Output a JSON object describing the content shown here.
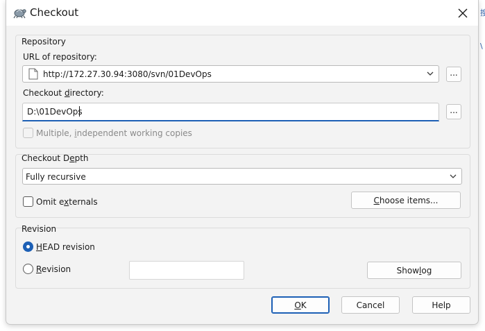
{
  "window": {
    "title": "Checkout",
    "accent": "#1c5fb5"
  },
  "background": {
    "glyph_1": "搜",
    "glyph_2": "\\"
  },
  "repository": {
    "group_label": "Repository",
    "url_label": "URL of repository:",
    "url_value": "http://172.27.30.94:3080/svn/01DevOps",
    "url_browse_label": "...",
    "dir_label_pre": "Checkout ",
    "dir_label_key": "d",
    "dir_label_post": "irectory:",
    "dir_value": "D:\\01DevOps",
    "dir_browse_label": "...",
    "multiple_pre": "Multiple, ",
    "multiple_key": "i",
    "multiple_post": "ndependent working copies"
  },
  "depth": {
    "group_label_pre": "Checkout D",
    "group_label_key": "e",
    "group_label_post": "pth",
    "selected": "Fully recursive",
    "omit_pre": "Omit e",
    "omit_key": "x",
    "omit_post": "ternals",
    "choose_key": "C",
    "choose_post": "hoose items..."
  },
  "revision": {
    "group_label": "Revision",
    "head_key": "H",
    "head_post": "EAD revision",
    "rev_key": "R",
    "rev_post": "evision",
    "rev_value": "",
    "showlog_pre": "Show ",
    "showlog_key": "l",
    "showlog_post": "og"
  },
  "buttons": {
    "ok_key": "O",
    "ok_post": "K",
    "cancel": "Cancel",
    "help": "Help"
  }
}
